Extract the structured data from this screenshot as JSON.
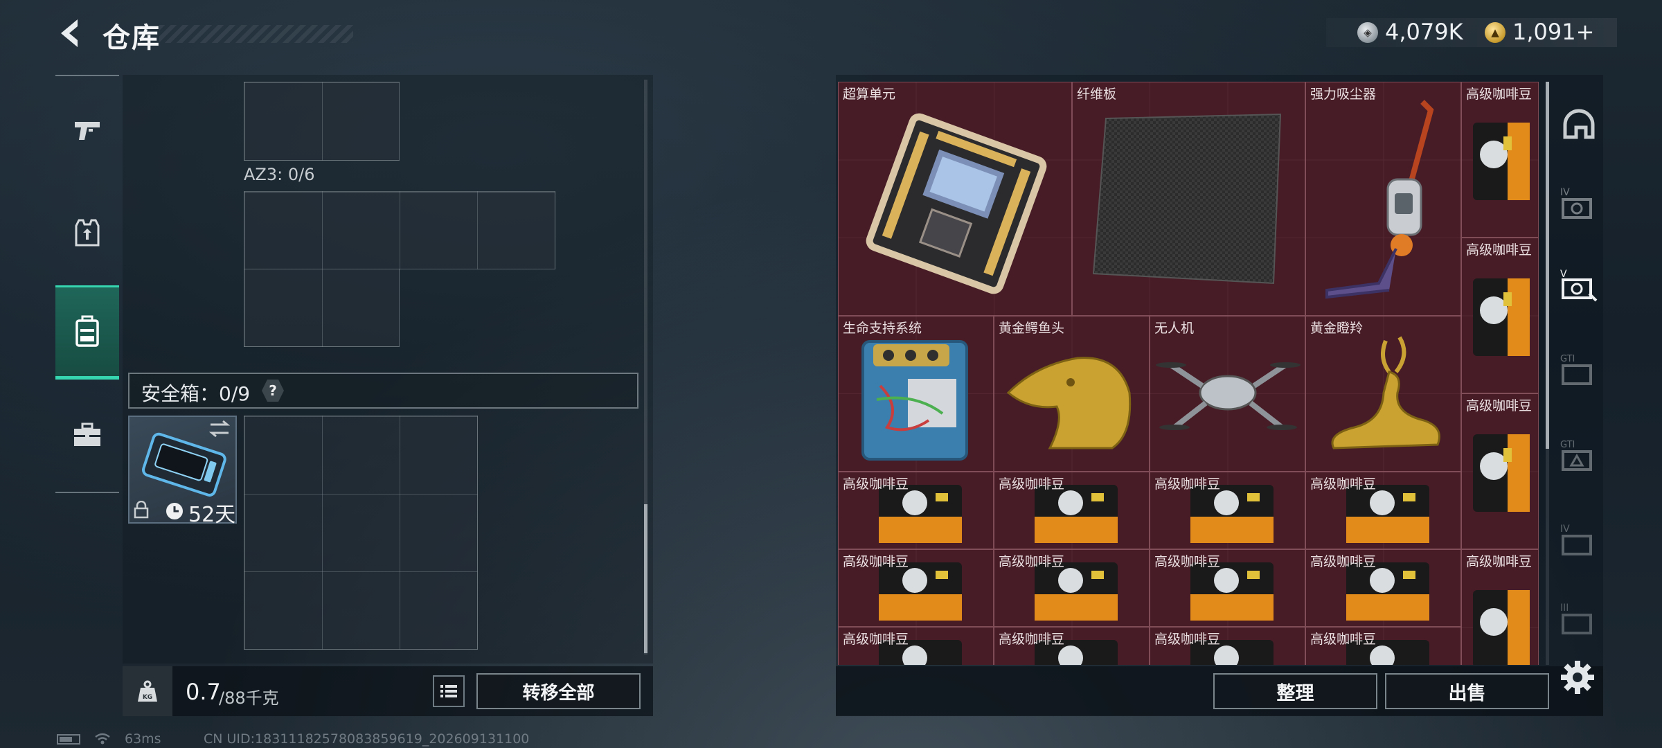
{
  "header": {
    "title": "仓库"
  },
  "currency": {
    "silver_amount": "4,079K",
    "gold_amount": "1,091+",
    "silver_color": "#b9c1c6",
    "gold_color": "#d4a63a"
  },
  "left_rail": {
    "items": [
      {
        "icon": "pistol-icon"
      },
      {
        "icon": "armor-vest-icon"
      },
      {
        "icon": "backpack-icon",
        "selected": true
      },
      {
        "icon": "briefcase-icon"
      }
    ],
    "selected_color": "#35d6b0"
  },
  "inventory": {
    "az3_label": "AZ3: 0/6",
    "safe_box_label": "安全箱：0/9",
    "safe_box_help": "?",
    "safe_case_timer": "52天"
  },
  "weight": {
    "current": "0.7",
    "max": "/88千克"
  },
  "buttons": {
    "transfer_all": "转移全部",
    "organize": "整理",
    "sell": "出售"
  },
  "stash": {
    "background_color": "#4c1e29",
    "items": [
      {
        "name": "超算单元"
      },
      {
        "name": "纤维板"
      },
      {
        "name": "强力吸尘器"
      },
      {
        "name": "高级咖啡豆"
      },
      {
        "name": "高级咖啡豆"
      },
      {
        "name": "生命支持系统"
      },
      {
        "name": "黄金鳄鱼头"
      },
      {
        "name": "无人机"
      },
      {
        "name": "黄金瞪羚"
      },
      {
        "name": "高级咖啡豆"
      },
      {
        "name": "高级咖啡豆"
      },
      {
        "name": "高级咖啡豆"
      },
      {
        "name": "高级咖啡豆"
      },
      {
        "name": "高级咖啡豆"
      },
      {
        "name": "高级咖啡豆"
      },
      {
        "name": "高级咖啡豆"
      },
      {
        "name": "高级咖啡豆"
      },
      {
        "name": "高级咖啡豆"
      },
      {
        "name": "高级咖啡豆"
      },
      {
        "name": "高级咖啡豆"
      },
      {
        "name": "高级咖啡豆"
      },
      {
        "name": "高级咖啡豆"
      },
      {
        "name": "高级咖啡豆"
      }
    ]
  },
  "side_rail": {
    "icons": [
      "helmet-icon",
      "attachment-iv-icon",
      "attachment-v-icon",
      "attachment-gti-icon",
      "attachment-gti-alt-icon",
      "attachment-iv-alt-icon",
      "attachment-iii-icon"
    ]
  },
  "status": {
    "ping": "63ms",
    "uid": "CN UID:18311182578083859619_202609131100"
  }
}
